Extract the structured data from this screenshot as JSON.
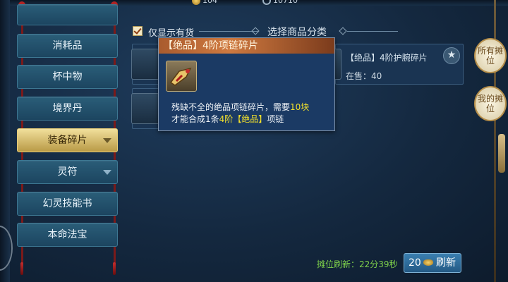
{
  "resources": {
    "coins": "104",
    "stamina": "10710"
  },
  "sidebar": {
    "items": [
      {
        "label": "消耗品",
        "has_arrow": false,
        "active": false
      },
      {
        "label": "杯中物",
        "has_arrow": false,
        "active": false
      },
      {
        "label": "境界丹",
        "has_arrow": false,
        "active": false
      },
      {
        "label": "装备碎片",
        "has_arrow": true,
        "active": true
      },
      {
        "label": "灵符",
        "has_arrow": true,
        "active": false
      },
      {
        "label": "幻灵技能书",
        "has_arrow": false,
        "active": false
      },
      {
        "label": "本命法宝",
        "has_arrow": false,
        "active": false
      }
    ]
  },
  "filter": {
    "show_in_stock_label": "仅显示有货",
    "show_in_stock_checked": true,
    "select_category_label": "选择商品分类"
  },
  "items": [
    {
      "name": "【绝品】4阶护腕碎片",
      "stock": "在售：40"
    }
  ],
  "tooltip": {
    "title": "【绝品】4阶项链碎片",
    "line1_pre": "残缺不全的绝品项链碎片，需要",
    "line1_highlight": "10块",
    "line2_pre": "才能合成1条",
    "line2_highlight": "4阶【绝品】",
    "line2_post": "项链"
  },
  "footer": {
    "refresh_label": "摊位刷新：22分39秒",
    "refresh_cost": "20",
    "refresh_button": "刷新"
  },
  "right_panel": {
    "tab1": "所有摊位",
    "tab2": "我的摊位"
  },
  "colors": {
    "accent_gold": "#f1df9b",
    "highlight_yellow": "#f2e02c",
    "timer_green": "#7fd24b",
    "tooltip_header": "#cf7a40"
  }
}
